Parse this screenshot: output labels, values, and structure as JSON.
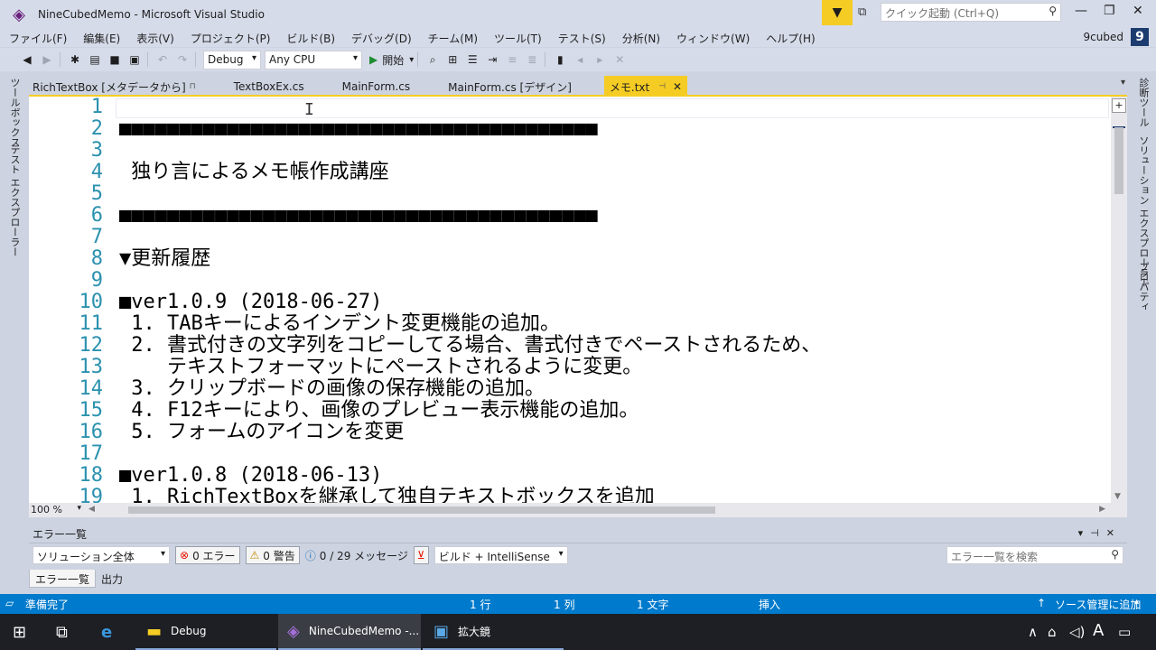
{
  "window": {
    "title": "NineCubedMemo - Microsoft Visual Studio",
    "quick_launch_placeholder": "クイック起動 (Ctrl+Q)",
    "account": "9cubed",
    "avatar_letter": "9"
  },
  "menu": [
    "ファイル(F)",
    "編集(E)",
    "表示(V)",
    "プロジェクト(P)",
    "ビルド(B)",
    "デバッグ(D)",
    "チーム(M)",
    "ツール(T)",
    "テスト(S)",
    "分析(N)",
    "ウィンドウ(W)",
    "ヘルプ(H)"
  ],
  "toolbar": {
    "config": "Debug",
    "platform": "Any CPU",
    "start_label": "開始"
  },
  "left_tabs": [
    "ツールボックス",
    "テスト エクスプローラー"
  ],
  "right_tabs": [
    "診断ツール",
    "ソリューション エクスプローラー",
    "プロパティ"
  ],
  "tabs": [
    {
      "label": "RichTextBox [メタデータから]",
      "pinned": true,
      "active": false
    },
    {
      "label": "TextBoxEx.cs",
      "pinned": false,
      "active": false
    },
    {
      "label": "MainForm.cs",
      "pinned": false,
      "active": false
    },
    {
      "label": "MainForm.cs [デザイン]",
      "pinned": false,
      "active": false
    },
    {
      "label": "メモ.txt",
      "pinned": true,
      "active": true
    }
  ],
  "editor": {
    "line_numbers": [
      "1",
      "2",
      "3",
      "4",
      "5",
      "6",
      "7",
      "8",
      "9",
      "10",
      "11",
      "12",
      "13",
      "14",
      "15",
      "16",
      "17",
      "18",
      "19"
    ],
    "lines": [
      "",
      "■■■■■■■■■■■■■■■■■■■■■■■■■■■■■■■■■■■■■■■■",
      "",
      " 独り言によるメモ帳作成講座",
      "",
      "■■■■■■■■■■■■■■■■■■■■■■■■■■■■■■■■■■■■■■■■",
      "",
      "▼更新履歴",
      "",
      "■ver1.0.9 (2018-06-27)",
      " 1. TABキーによるインデント変更機能の追加。",
      " 2. 書式付きの文字列をコピーしてる場合、書式付きでペーストされるため、",
      "    テキストフォーマットにペーストされるように変更。",
      " 3. クリップボードの画像の保存機能の追加。",
      " 4. F12キーにより、画像のプレビュー表示機能の追加。",
      " 5. フォームのアイコンを変更",
      "",
      "■ver1.0.8 (2018-06-13)",
      " 1. RichTextBoxを継承して独自テキストボックスを追加"
    ],
    "zoom": "100 %"
  },
  "error_list": {
    "title": "エラー一覧",
    "scope": "ソリューション全体",
    "errors": "0 エラー",
    "warnings": "0 警告",
    "messages": "0 / 29 メッセージ",
    "build_filter": "ビルド + IntelliSense",
    "search_placeholder": "エラー一覧を検索",
    "bottom_tabs": [
      "エラー一覧",
      "出力"
    ]
  },
  "status": {
    "ready": "準備完了",
    "line": "1 行",
    "col": "1 列",
    "char": "1 文字",
    "mode": "挿入",
    "source_control": "ソース管理に追加"
  },
  "taskbar": {
    "items": [
      {
        "label": "Debug",
        "state": "open"
      },
      {
        "label": "NineCubedMemo -...",
        "state": "active"
      },
      {
        "label": "拡大鏡",
        "state": "open"
      }
    ],
    "ime": "A"
  },
  "colors": {
    "accent": "#f5cc24",
    "statusbar": "#007acc",
    "line_number": "#2b91af",
    "chrome": "#cdd3e0"
  }
}
